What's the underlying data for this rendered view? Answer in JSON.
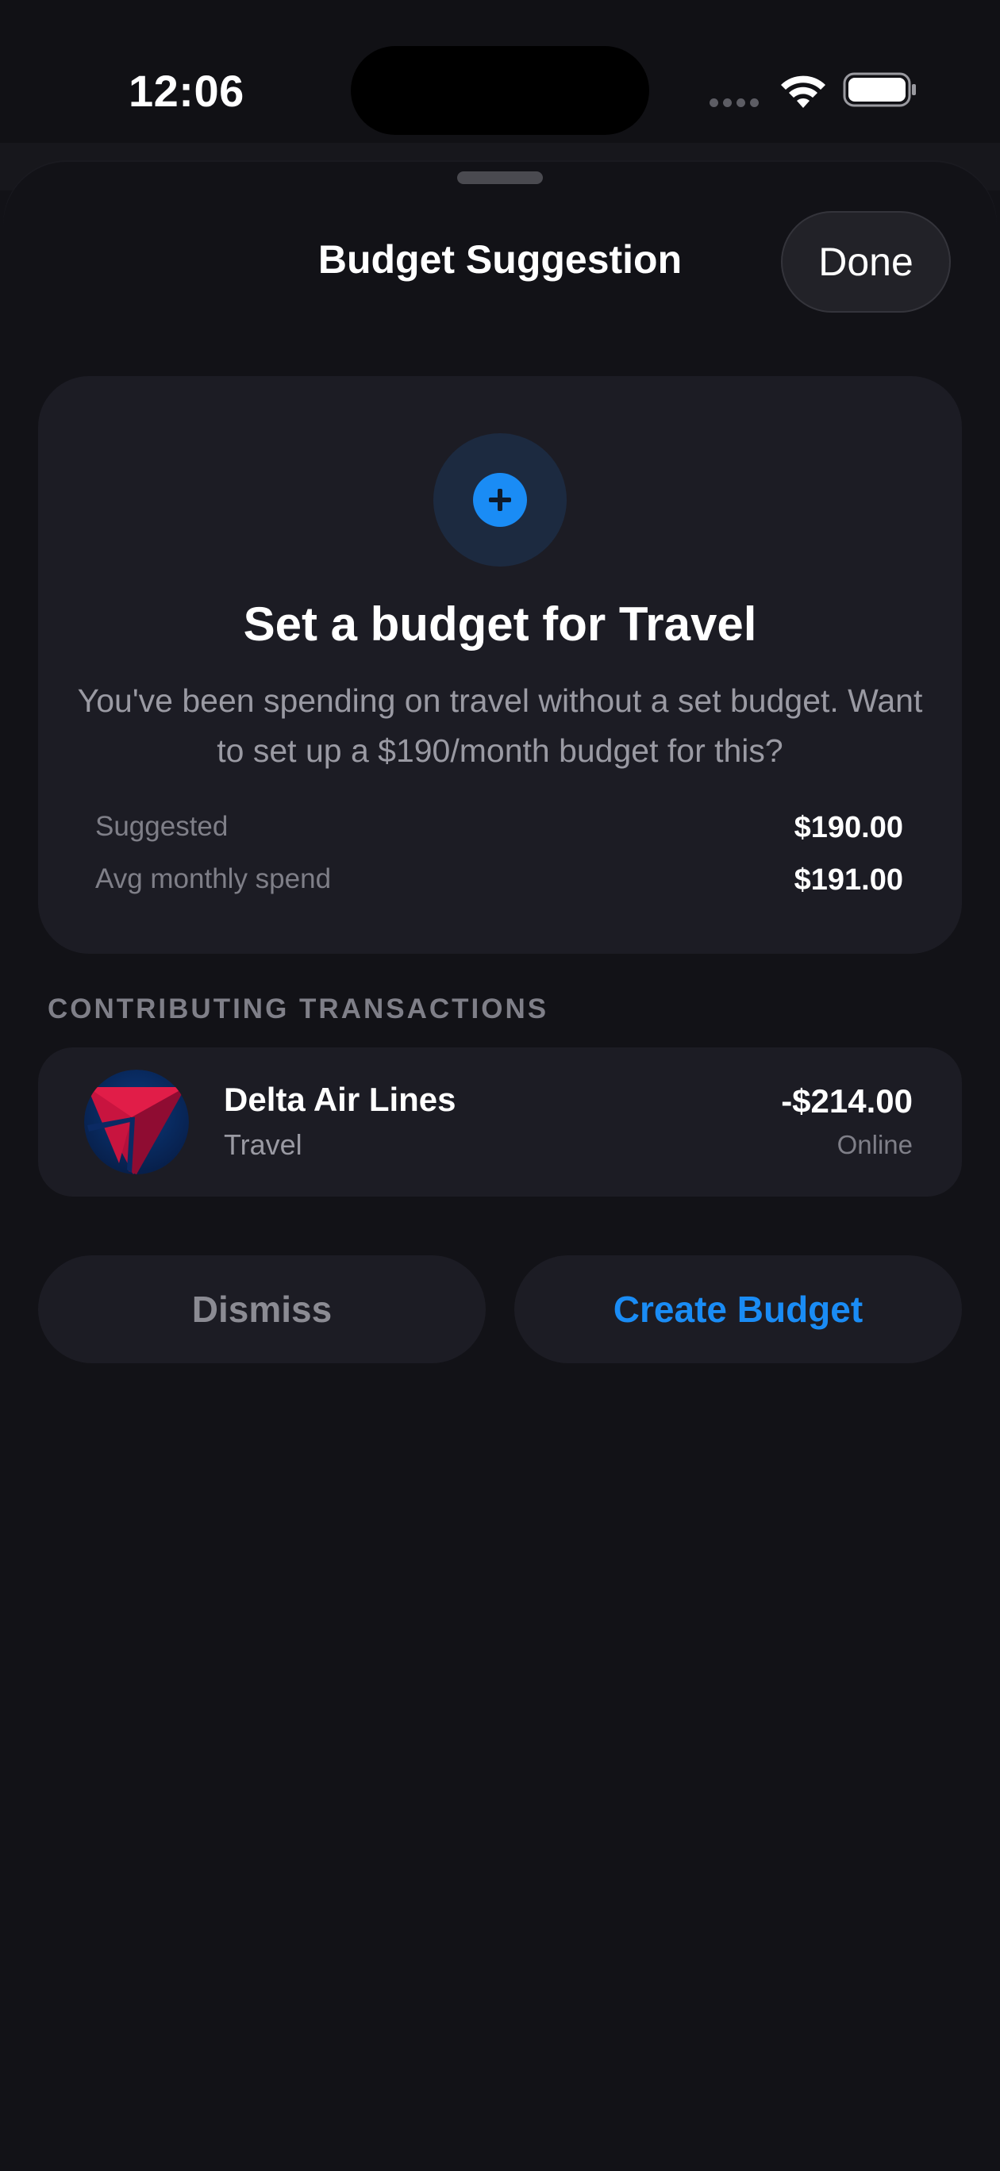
{
  "status_bar": {
    "time": "12:06",
    "icons": [
      "signal-dots-icon",
      "wifi-icon",
      "battery-icon"
    ]
  },
  "sheet": {
    "title": "Budget Suggestion",
    "done_label": "Done"
  },
  "suggestion": {
    "icon": "plus-circle-icon",
    "headline": "Set a budget for Travel",
    "body": "You've been spending on travel without a set budget. Want to set up a $190/month budget for this?",
    "stats": [
      {
        "label": "Suggested",
        "value": "$190.00"
      },
      {
        "label": "Avg monthly spend",
        "value": "$191.00"
      }
    ]
  },
  "transactions": {
    "header": "CONTRIBUTING TRANSACTIONS",
    "items": [
      {
        "merchant": "Delta Air Lines",
        "category": "Travel",
        "amount": "-$214.00",
        "method": "Online",
        "logo": "delta-logo-icon"
      }
    ]
  },
  "actions": {
    "dismiss_label": "Dismiss",
    "create_label": "Create Budget"
  },
  "colors": {
    "accent": "#1a8cf5",
    "background": "#121217",
    "card": "#1c1c24",
    "secondary_text": "#9a9aa3",
    "tertiary_text": "#7f7f88"
  }
}
